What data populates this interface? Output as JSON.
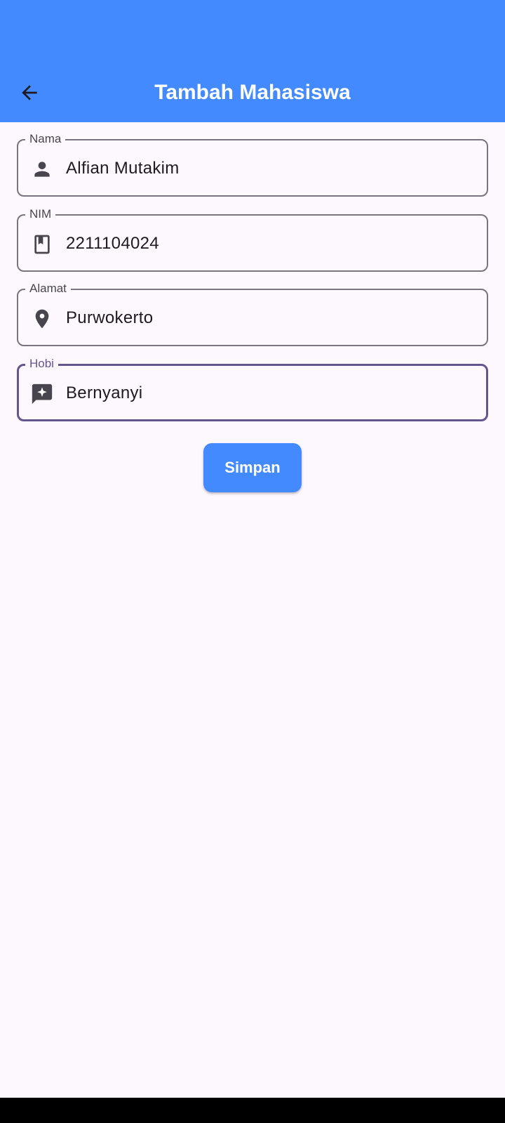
{
  "app_bar": {
    "title": "Tambah Mahasiswa",
    "back_icon": "arrow-back-icon",
    "background": "#448aff"
  },
  "form": {
    "fields": [
      {
        "label": "Nama",
        "value": "Alfian Mutakim",
        "icon": "person-icon",
        "focused": false
      },
      {
        "label": "NIM",
        "value": "2211104024",
        "icon": "book-icon",
        "focused": false
      },
      {
        "label": "Alamat",
        "value": "Purwokerto",
        "icon": "location-pin-icon",
        "focused": false
      },
      {
        "label": "Hobi",
        "value": "Bernyanyi",
        "icon": "chat-sparkle-icon",
        "focused": true
      }
    ],
    "submit_label": "Simpan"
  },
  "colors": {
    "accent": "#448aff",
    "focus": "#65558f",
    "outline": "#79747e",
    "background": "#fdf7fe"
  }
}
